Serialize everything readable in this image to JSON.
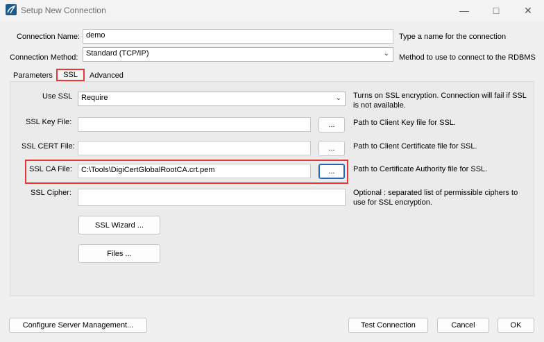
{
  "window": {
    "title": "Setup New Connection",
    "minimize_icon": "minimize-icon",
    "maximize_icon": "maximize-icon",
    "close_icon": "close-icon"
  },
  "connection": {
    "name_label": "Connection Name:",
    "name_value": "demo",
    "name_hint": "Type a name for the connection",
    "method_label": "Connection Method:",
    "method_value": "Standard (TCP/IP)",
    "method_hint": "Method to use to connect to the RDBMS"
  },
  "tabs": [
    {
      "label": "Parameters"
    },
    {
      "label": "SSL"
    },
    {
      "label": "Advanced"
    }
  ],
  "ssl": {
    "use_ssl_label": "Use SSL",
    "use_ssl_value": "Require",
    "use_ssl_hint": "Turns on SSL encryption. Connection will fail if SSL is not available.",
    "key_label": "SSL Key File:",
    "key_value": "",
    "key_hint": "Path to Client Key file for SSL.",
    "cert_label": "SSL CERT File:",
    "cert_value": "",
    "cert_hint": "Path to Client Certificate file for SSL.",
    "ca_label": "SSL CA File:",
    "ca_value": "C:\\Tools\\DigiCertGlobalRootCA.crt.pem",
    "ca_hint": "Path to Certificate Authority file for SSL.",
    "cipher_label": "SSL Cipher:",
    "cipher_value": "",
    "cipher_hint": "Optional : separated list of permissible ciphers to use for SSL encryption.",
    "browse_label": "...",
    "wizard_label": "SSL Wizard ...",
    "files_label": "Files ..."
  },
  "footer": {
    "configure_label": "Configure Server Management...",
    "test_label": "Test Connection",
    "cancel_label": "Cancel",
    "ok_label": "OK"
  },
  "colors": {
    "highlight": "#e53935",
    "focus": "#2a64b8"
  }
}
